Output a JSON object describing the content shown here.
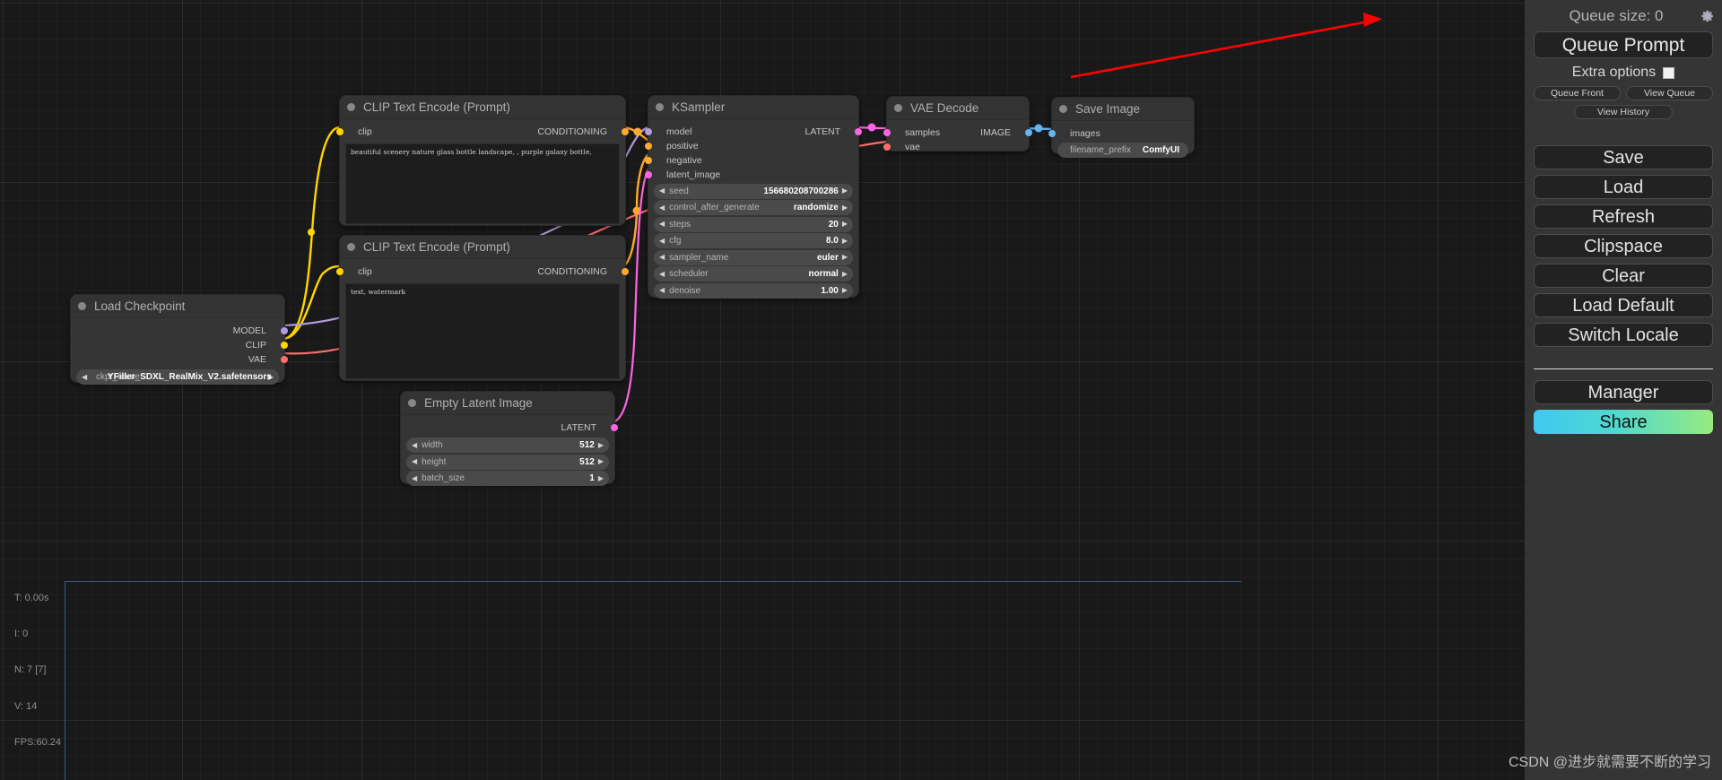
{
  "panel": {
    "queue_size_label": "Queue size: 0",
    "gear_icon": "gear-icon",
    "queue_prompt_label": "Queue Prompt",
    "extra_options_label": "Extra options",
    "queue_front_label": "Queue Front",
    "view_queue_label": "View Queue",
    "view_history_label": "View History",
    "buttons": [
      {
        "label": "Save"
      },
      {
        "label": "Load"
      },
      {
        "label": "Refresh"
      },
      {
        "label": "Clipspace"
      },
      {
        "label": "Clear"
      },
      {
        "label": "Load Default"
      },
      {
        "label": "Switch Locale"
      }
    ],
    "manager_label": "Manager",
    "share_label": "Share",
    "share_gradient": [
      "#3ec9f0",
      "#96eb7f"
    ]
  },
  "stats": {
    "time": "T: 0.00s",
    "iterations": "I: 0",
    "nodes": "N: 7 [7]",
    "vertices": "V: 14",
    "fps": "FPS:60.24"
  },
  "watermark": "CSDN @进步就需要不断的学习",
  "nodes": {
    "clip_positive": {
      "title": "CLIP Text Encode (Prompt)",
      "input_label": "clip",
      "output_label": "CONDITIONING",
      "text": "beautiful scenery nature glass bottle landscape, , purple galaxy bottle,"
    },
    "clip_negative": {
      "title": "CLIP Text Encode (Prompt)",
      "input_label": "clip",
      "output_label": "CONDITIONING",
      "text": "text, watermark"
    },
    "load_checkpoint": {
      "title": "Load Checkpoint",
      "outputs": [
        "MODEL",
        "CLIP",
        "VAE"
      ],
      "widget_name": "ckpt_name",
      "widget_value": "YFiller_SDXL_RealMix_V2.safetensors"
    },
    "ksampler": {
      "title": "KSampler",
      "inputs": [
        "model",
        "positive",
        "negative",
        "latent_image"
      ],
      "output_label": "LATENT",
      "widgets": [
        {
          "name": "seed",
          "value": "156680208700286"
        },
        {
          "name": "control_after_generate",
          "value": "randomize"
        },
        {
          "name": "steps",
          "value": "20"
        },
        {
          "name": "cfg",
          "value": "8.0"
        },
        {
          "name": "sampler_name",
          "value": "euler"
        },
        {
          "name": "scheduler",
          "value": "normal"
        },
        {
          "name": "denoise",
          "value": "1.00"
        }
      ]
    },
    "empty_latent": {
      "title": "Empty Latent Image",
      "output_label": "LATENT",
      "widgets": [
        {
          "name": "width",
          "value": "512"
        },
        {
          "name": "height",
          "value": "512"
        },
        {
          "name": "batch_size",
          "value": "1"
        }
      ]
    },
    "vae_decode": {
      "title": "VAE Decode",
      "inputs": [
        "samples",
        "vae"
      ],
      "output_label": "IMAGE"
    },
    "save_image": {
      "title": "Save Image",
      "input_label": "images",
      "widget_name": "filename_prefix",
      "widget_value": "ComfyUI"
    }
  },
  "colors": {
    "clip_port": "#FFD500",
    "conditioning_port": "#FFA931",
    "model_port": "#B39DDB",
    "vae_port": "#FF6E6E",
    "latent_port": "#FF64E4",
    "image_port": "#64B5F6",
    "annotation_arrow": "#FF0000"
  }
}
